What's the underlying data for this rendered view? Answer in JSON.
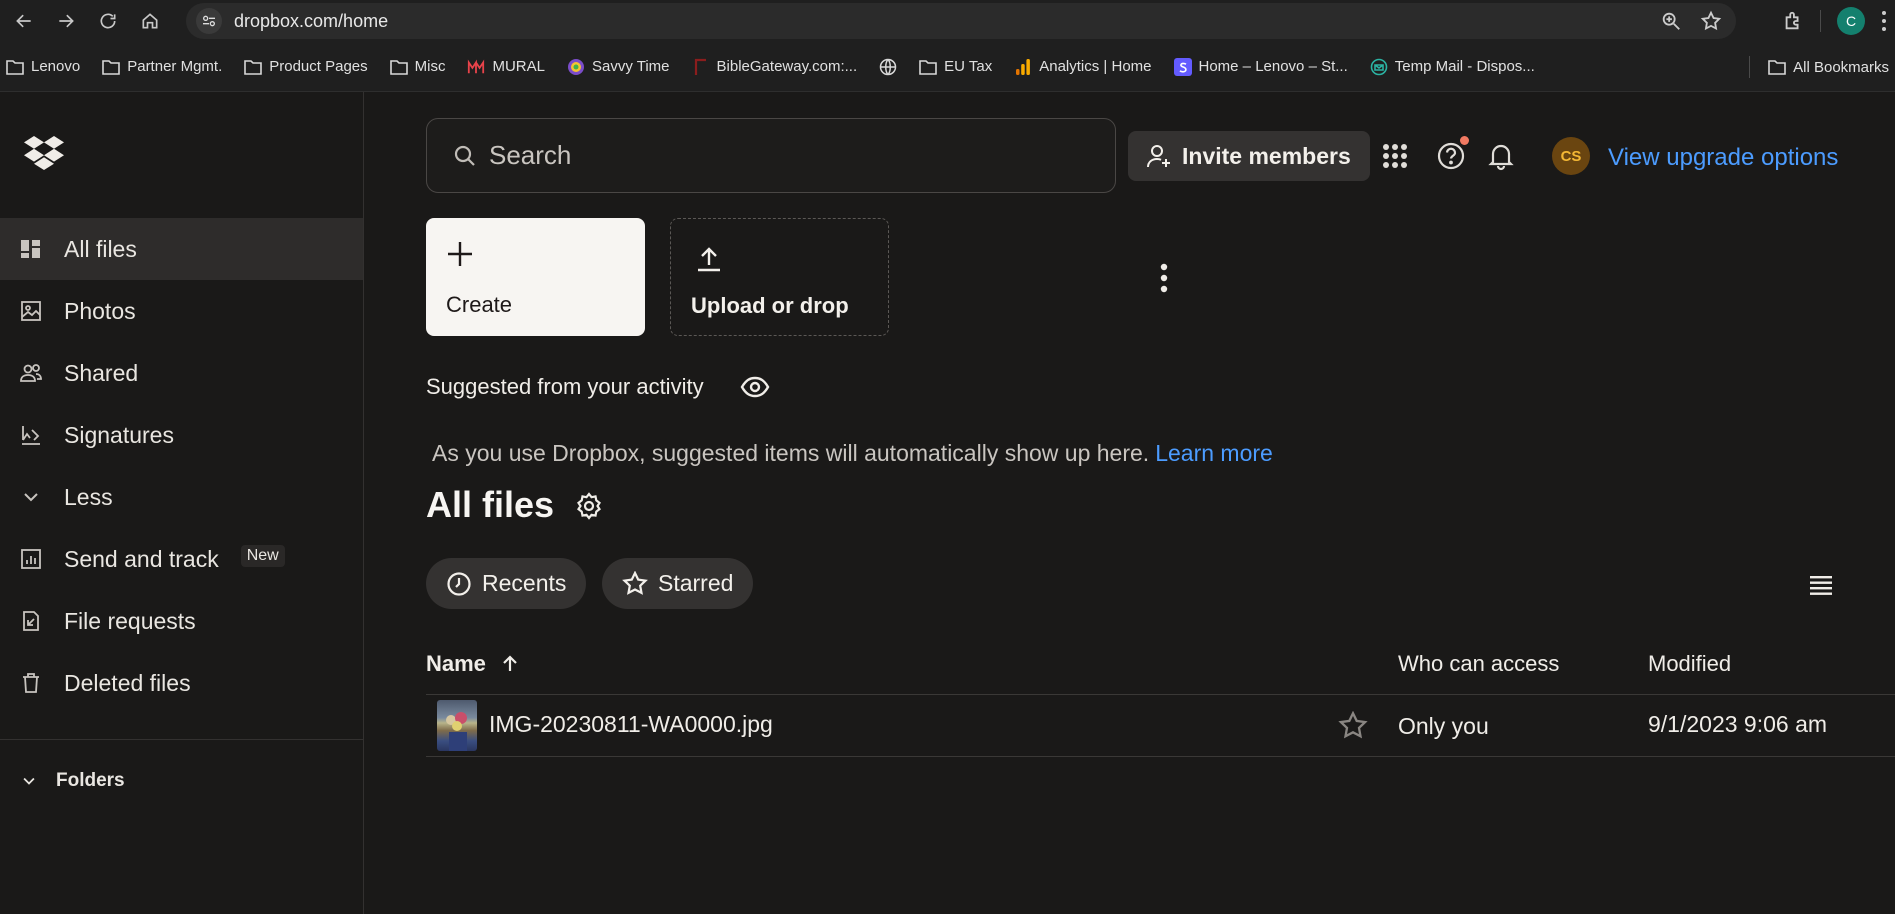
{
  "browser": {
    "url": "dropbox.com/home",
    "profile_initial": "C",
    "bookmarks": [
      {
        "label": "Lenovo",
        "icon": "folder-icon"
      },
      {
        "label": "Partner Mgmt.",
        "icon": "folder-icon"
      },
      {
        "label": "Product Pages",
        "icon": "folder-icon"
      },
      {
        "label": "Misc",
        "icon": "folder-icon"
      },
      {
        "label": "MURAL",
        "icon": "mural-icon",
        "color": "#e8434a"
      },
      {
        "label": "Savvy Time",
        "icon": "savvy-time-icon"
      },
      {
        "label": "BibleGateway.com:...",
        "icon": "biblegateway-icon",
        "color": "#8b1d1d"
      },
      {
        "label": "",
        "icon": "globe-icon"
      },
      {
        "label": "EU Tax",
        "icon": "folder-icon"
      },
      {
        "label": "Analytics | Home",
        "icon": "analytics-icon",
        "color": "#f9ab00"
      },
      {
        "label": "Home – Lenovo – St...",
        "icon": "stripe-icon",
        "color": "#635bff"
      },
      {
        "label": "Temp Mail - Dispos...",
        "icon": "temp-mail-icon",
        "color": "#2bb3a3"
      }
    ],
    "all_bookmarks": "All Bookmarks"
  },
  "sidebar": {
    "items": [
      {
        "label": "All files",
        "icon": "all-files-icon",
        "active": true
      },
      {
        "label": "Photos",
        "icon": "photos-icon"
      },
      {
        "label": "Shared",
        "icon": "shared-icon"
      },
      {
        "label": "Signatures",
        "icon": "signatures-icon"
      },
      {
        "label": "Less",
        "icon": "chevron-down-icon"
      },
      {
        "label": "Send and track",
        "icon": "send-track-icon",
        "badge": "New"
      },
      {
        "label": "File requests",
        "icon": "file-requests-icon"
      },
      {
        "label": "Deleted files",
        "icon": "trash-icon"
      }
    ],
    "folders_label": "Folders"
  },
  "header": {
    "search_placeholder": "Search",
    "invite_label": "Invite members",
    "avatar_initials": "CS",
    "upgrade_label": "View upgrade options"
  },
  "actions": {
    "create_label": "Create",
    "upload_label": "Upload or drop"
  },
  "suggested": {
    "title": "Suggested from your activity",
    "text": "As you use Dropbox, suggested items will automatically show up here.",
    "learn_more": "Learn more"
  },
  "files": {
    "heading": "All files",
    "filters": [
      {
        "label": "Recents",
        "icon": "clock-icon"
      },
      {
        "label": "Starred",
        "icon": "star-icon"
      }
    ],
    "columns": {
      "name": "Name",
      "access": "Who can access",
      "modified": "Modified"
    },
    "rows": [
      {
        "name": "IMG-20230811-WA0000.jpg",
        "access": "Only you",
        "modified": "9/1/2023 9:06 am"
      }
    ]
  },
  "colors": {
    "accent_link": "#4c9cff",
    "background": "#1a1918",
    "avatar_bg": "#6a4510",
    "avatar_fg": "#f3b735"
  }
}
